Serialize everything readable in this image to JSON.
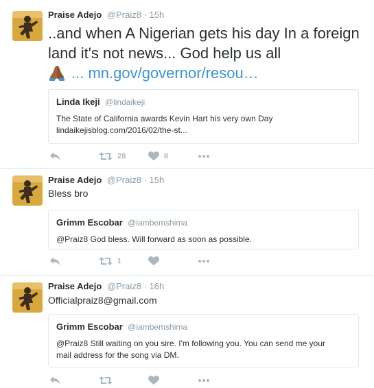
{
  "tweets": [
    {
      "name": "Praise Adejo",
      "handle": "@Praiz8",
      "separator": "·",
      "time": "15h",
      "text": "..and when A Nigerian gets his day In a foreign land it's not news... God help us all",
      "link": "... mn.gov/governor/resou…",
      "quote": {
        "name": "Linda Ikeji",
        "handle": "@lindaikeji",
        "line1": "The State of California awards Kevin Hart his very own Day",
        "line2": "lindaikejisblog.com/2016/02/the-st..."
      },
      "retweets": "28",
      "likes": "8"
    },
    {
      "name": "Praise Adejo",
      "handle": "@Praiz8",
      "separator": "·",
      "time": "15h",
      "text": "Bless bro",
      "quote": {
        "name": "Grimm Escobar",
        "handle": "@iambemshima",
        "line1": "@Praiz8 God bless. Will forward as soon as possible."
      },
      "retweets": "1",
      "likes": ""
    },
    {
      "name": "Praise Adejo",
      "handle": "@Praiz8",
      "separator": "·",
      "time": "16h",
      "text": "Officialpraiz8@gmail.com",
      "quote": {
        "name": "Grimm Escobar",
        "handle": "@iambemshima",
        "line1": "@Praiz8 Still waiting on you sire. I'm following you. You can send me your",
        "line2": "mail address for the song via DM."
      },
      "retweets": "",
      "likes": ""
    }
  ],
  "icons": {
    "reply": "reply-icon",
    "retweet": "retweet-icon",
    "like": "heart-icon",
    "more": "more-icon",
    "emoji": "folded-hands-icon"
  },
  "colors": {
    "link": "#3b94d9",
    "muted": "#8899a6",
    "action": "#aab8c2",
    "border": "#e1e8ed",
    "avatar": "#d9a83c"
  }
}
